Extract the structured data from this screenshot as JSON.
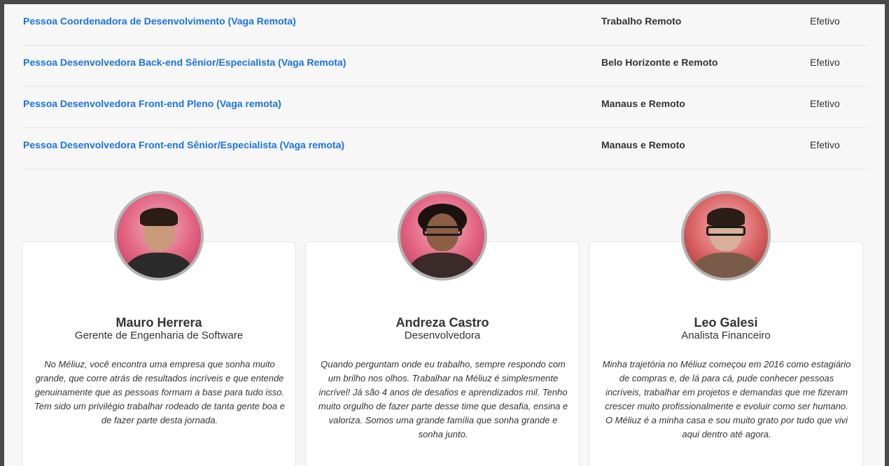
{
  "jobs": [
    {
      "title": "Pessoa Coordenadora de Desenvolvimento (Vaga Remota)",
      "location": "Trabalho Remoto",
      "type": "Efetivo"
    },
    {
      "title": "Pessoa Desenvolvedora Back-end Sênior/Especialista (Vaga Remota)",
      "location": "Belo Horizonte e Remoto",
      "type": "Efetivo"
    },
    {
      "title": "Pessoa Desenvolvedora Front-end Pleno (Vaga remota)",
      "location": "Manaus e Remoto",
      "type": "Efetivo"
    },
    {
      "title": "Pessoa Desenvolvedora Front-end Sênior/Especialista (Vaga remota)",
      "location": "Manaus e Remoto",
      "type": "Efetivo"
    }
  ],
  "testimonials": [
    {
      "name": "Mauro Herrera",
      "role": "Gerente de Engenharia de Software",
      "quote": "No Méliuz, você encontra uma empresa que sonha muito grande, que corre atrás de resultados incríveis e que entende genuinamente que as pessoas formam a base para tudo isso. Tem sido um privilégio trabalhar rodeado de tanta gente boa e de fazer parte desta jornada."
    },
    {
      "name": "Andreza Castro",
      "role": "Desenvolvedora",
      "quote": "Quando perguntam onde eu trabalho, sempre respondo com um brilho nos olhos. Trabalhar na Méliuz é simplesmente incrível! Já são 4 anos de desafios e aprendizados mil. Tenho muito orgulho de fazer parte desse time que desafia, ensina e valoriza. Somos uma grande família que sonha grande e sonha junto."
    },
    {
      "name": "Leo Galesi",
      "role": "Analista Financeiro",
      "quote": "Minha trajetória no Méliuz começou em 2016 como estagiário de compras e, de lá para cá, pude conhecer pessoas incríveis, trabalhar em projetos e demandas que me fizeram crescer muito profissionalmente e evoluir como ser humano. O Méliuz é a minha casa e sou muito grato por tudo que vivi aqui dentro até agora."
    }
  ],
  "colors": {
    "link": "#1a73e8",
    "text": "#333333",
    "frame": "#4a4a4a",
    "background": "#f7f7f7"
  }
}
